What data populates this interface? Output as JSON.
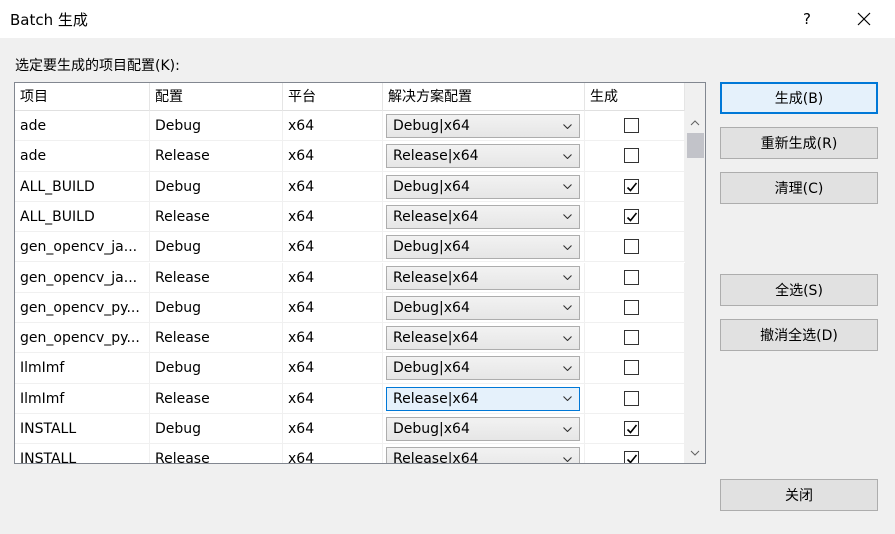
{
  "window": {
    "title": "Batch 生成",
    "help": "?"
  },
  "prompt": "选定要生成的项目配置(K):",
  "columns": [
    "项目",
    "配置",
    "平台",
    "解决方案配置",
    "生成"
  ],
  "rows": [
    {
      "project": "ade",
      "config": "Debug",
      "platform": "x64",
      "solution_config": "Debug|x64",
      "build": false
    },
    {
      "project": "ade",
      "config": "Release",
      "platform": "x64",
      "solution_config": "Release|x64",
      "build": false
    },
    {
      "project": "ALL_BUILD",
      "config": "Debug",
      "platform": "x64",
      "solution_config": "Debug|x64",
      "build": true
    },
    {
      "project": "ALL_BUILD",
      "config": "Release",
      "platform": "x64",
      "solution_config": "Release|x64",
      "build": true
    },
    {
      "project": "gen_opencv_ja...",
      "config": "Debug",
      "platform": "x64",
      "solution_config": "Debug|x64",
      "build": false
    },
    {
      "project": "gen_opencv_ja...",
      "config": "Release",
      "platform": "x64",
      "solution_config": "Release|x64",
      "build": false
    },
    {
      "project": "gen_opencv_py...",
      "config": "Debug",
      "platform": "x64",
      "solution_config": "Debug|x64",
      "build": false
    },
    {
      "project": "gen_opencv_py...",
      "config": "Release",
      "platform": "x64",
      "solution_config": "Release|x64",
      "build": false
    },
    {
      "project": "IlmImf",
      "config": "Debug",
      "platform": "x64",
      "solution_config": "Debug|x64",
      "build": false
    },
    {
      "project": "IlmImf",
      "config": "Release",
      "platform": "x64",
      "solution_config": "Release|x64",
      "build": false,
      "focused": true
    },
    {
      "project": "INSTALL",
      "config": "Debug",
      "platform": "x64",
      "solution_config": "Debug|x64",
      "build": true
    },
    {
      "project": "INSTALL",
      "config": "Release",
      "platform": "x64",
      "solution_config": "Release|x64",
      "build": true
    }
  ],
  "buttons": {
    "build": "生成(B)",
    "rebuild": "重新生成(R)",
    "clean": "清理(C)",
    "select_all": "全选(S)",
    "deselect_all": "撤消全选(D)",
    "close": "关闭"
  },
  "colors": {
    "accent": "#0078d7",
    "focus_bg": "#e5f1fb"
  }
}
